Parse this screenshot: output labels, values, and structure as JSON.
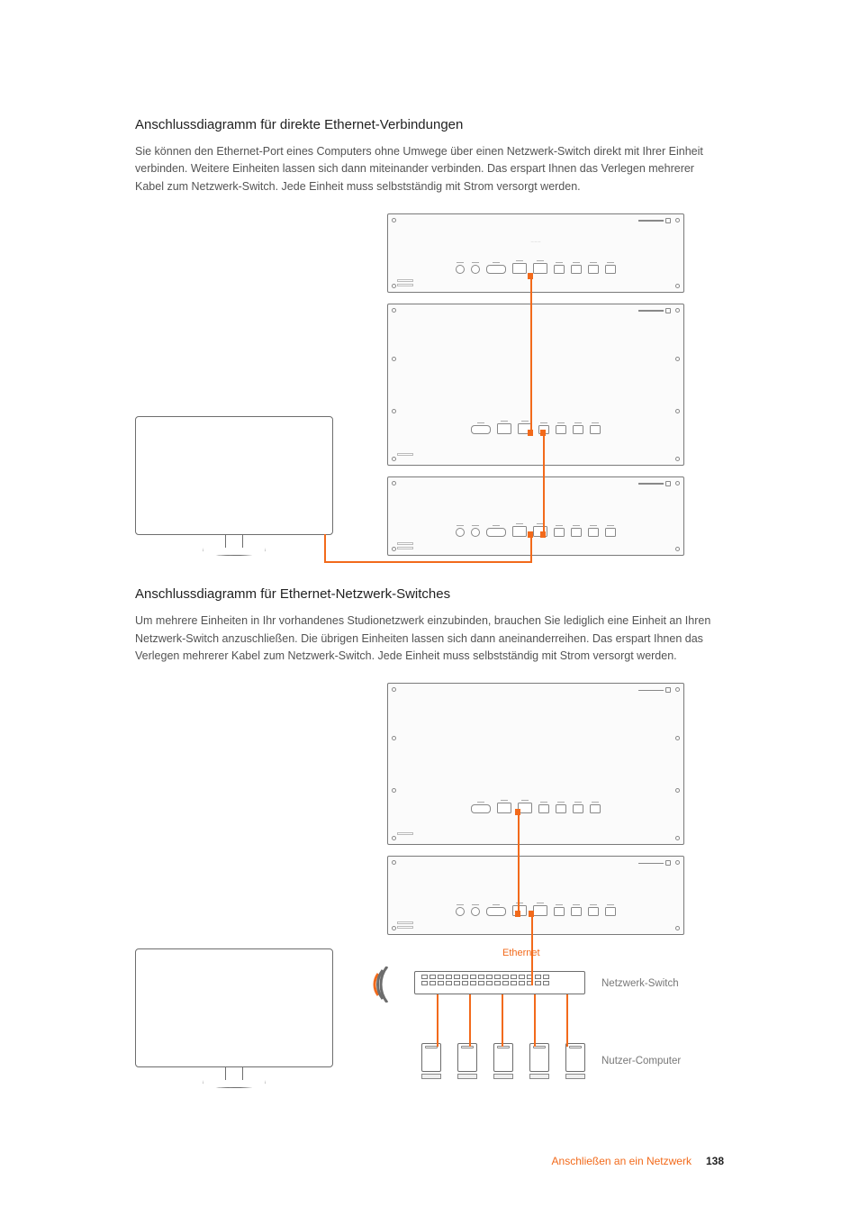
{
  "section1": {
    "heading": "Anschlussdiagramm für direkte Ethernet-Verbindungen",
    "body": "Sie können den Ethernet-Port eines Computers ohne Umwege über einen Netzwerk-Switch direkt mit Ihrer Einheit verbinden. Weitere Einheiten lassen sich dann miteinander verbinden. Das erspart Ihnen das Verlegen mehrerer Kabel zum Netzwerk-Switch. Jede Einheit muss selbstständig mit Strom versorgt werden."
  },
  "section2": {
    "heading": "Anschlussdiagramm für Ethernet-Netzwerk-Switches",
    "body": "Um mehrere Einheiten in Ihr vorhandenes Studionetzwerk einzubinden, brauchen Sie lediglich eine Einheit an Ihren Netzwerk-Switch anzuschließen. Die übrigen Einheiten lassen sich dann aneinanderreihen. Das erspart Ihnen das Verlegen mehrerer Kabel zum Netzwerk-Switch. Jede Einheit muss selbstständig mit Strom versorgt werden."
  },
  "labels": {
    "ethernet": "Ethernet",
    "networkSwitch": "Netzwerk-Switch",
    "userComputer": "Nutzer-Computer"
  },
  "footer": {
    "section": "Anschließen an ein Netzwerk",
    "page": "138"
  },
  "colors": {
    "cable": "#f26a1b",
    "stroke": "#6d6d6d"
  }
}
